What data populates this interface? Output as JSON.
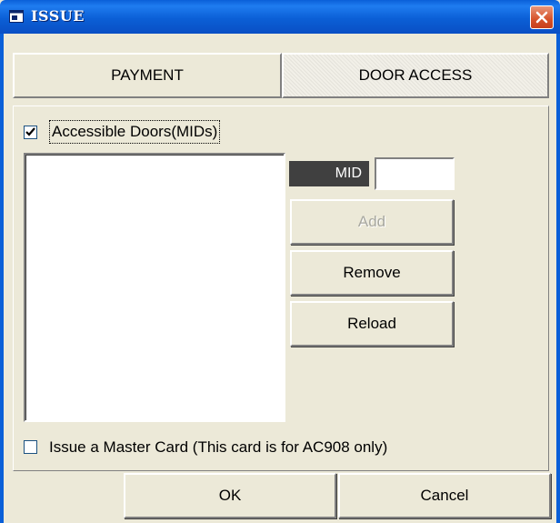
{
  "window": {
    "title": "ISSUE"
  },
  "tabs": [
    {
      "label": "PAYMENT"
    },
    {
      "label": "DOOR ACCESS"
    }
  ],
  "door_access": {
    "accessible_doors_label": "Accessible Doors(MIDs)",
    "accessible_doors_checked": true,
    "mid_label": "MID",
    "mid_value": "",
    "add_label": "Add",
    "remove_label": "Remove",
    "reload_label": "Reload",
    "master_card_label": "Issue a Master Card (This card is for AC908 only)",
    "master_card_checked": false
  },
  "footer": {
    "ok_label": "OK",
    "cancel_label": "Cancel"
  },
  "colors": {
    "titlebar": "#0a5fd8",
    "close_button": "#d6522a",
    "dialog_face": "#ece9d8",
    "mid_label_bg": "#404040"
  },
  "icons": {
    "app": "window-app-icon",
    "close": "close-icon",
    "check": "checkmark-icon"
  }
}
